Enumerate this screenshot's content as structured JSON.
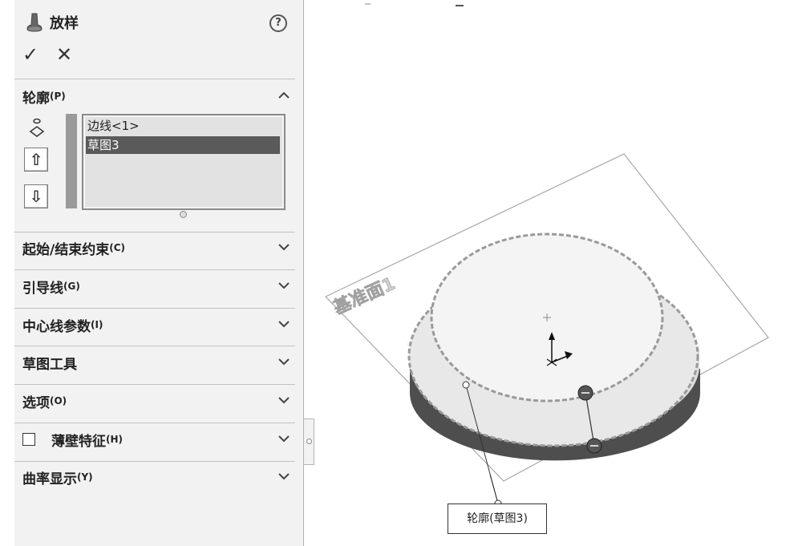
{
  "panel": {
    "title": "放样",
    "help": "?",
    "ok": "✓",
    "cancel": "✕",
    "profiles": {
      "label": "轮廓",
      "code": "(P)",
      "items": [
        {
          "label": "边线<1>",
          "selected": false
        },
        {
          "label": "草图3",
          "selected": true
        }
      ],
      "move_up": "⇧",
      "move_down": "⇩"
    },
    "sections": [
      {
        "label": "起始/结束约束",
        "code": "(C)"
      },
      {
        "label": "引导线",
        "code": "(G)"
      },
      {
        "label": "中心线参数",
        "code": "(I)"
      },
      {
        "label": "草图工具",
        "code": ""
      },
      {
        "label": "选项",
        "code": "(O)"
      },
      {
        "label": "薄壁特征",
        "code": "(H)",
        "checked": false
      },
      {
        "label": "曲率显示",
        "code": "(Y)"
      }
    ]
  },
  "viewport": {
    "plane_label": "基准面1",
    "callout": "轮廓(草图3)"
  }
}
